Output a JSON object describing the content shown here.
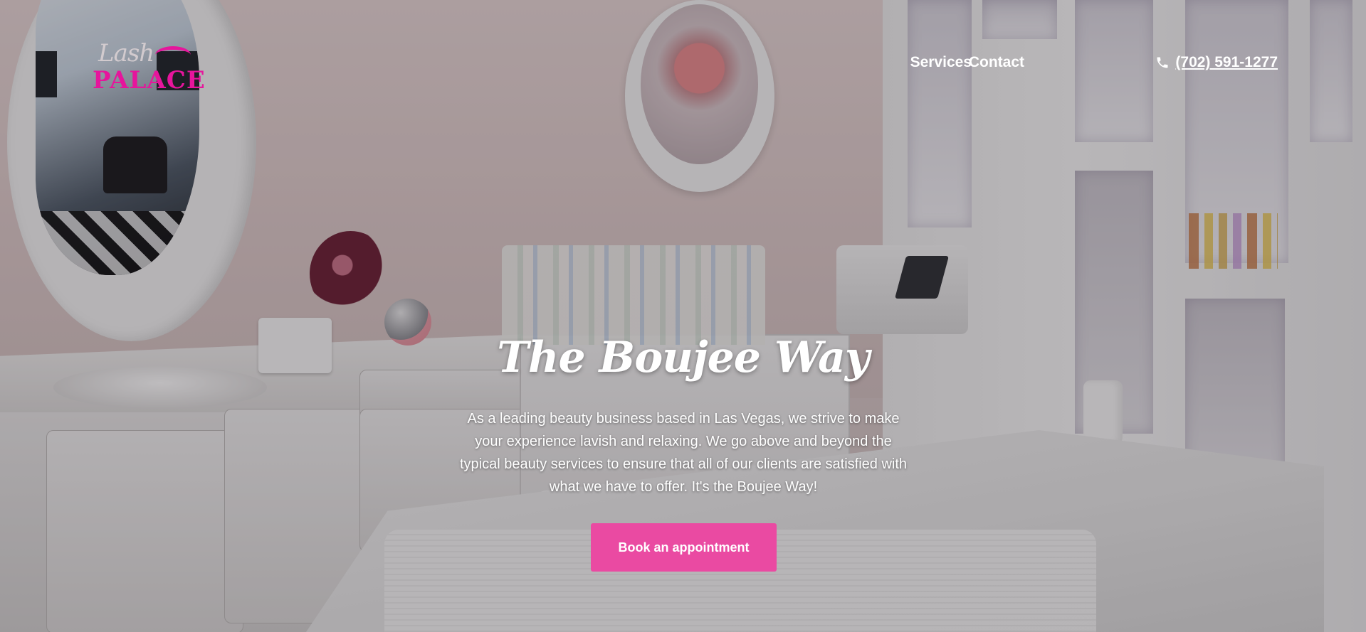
{
  "brand": {
    "logo_script": "Lash",
    "logo_word": "PALACE",
    "accent_color": "#e6159c"
  },
  "nav": {
    "items": [
      {
        "label": "Services"
      },
      {
        "label": "Contact"
      }
    ],
    "phone": {
      "icon": "phone-icon",
      "number": "(702) 591-1277"
    }
  },
  "hero": {
    "headline": "The Boujee Way",
    "intro": "As a leading beauty business based in Las Vegas, we strive to make your experience lavish and relaxing. We go above and beyond the typical beauty services to ensure that all of our clients are satisfied with what we have to offer. It's the Boujee Way!",
    "cta_label": "Book an appointment",
    "cta_color": "#ea4aa2"
  }
}
